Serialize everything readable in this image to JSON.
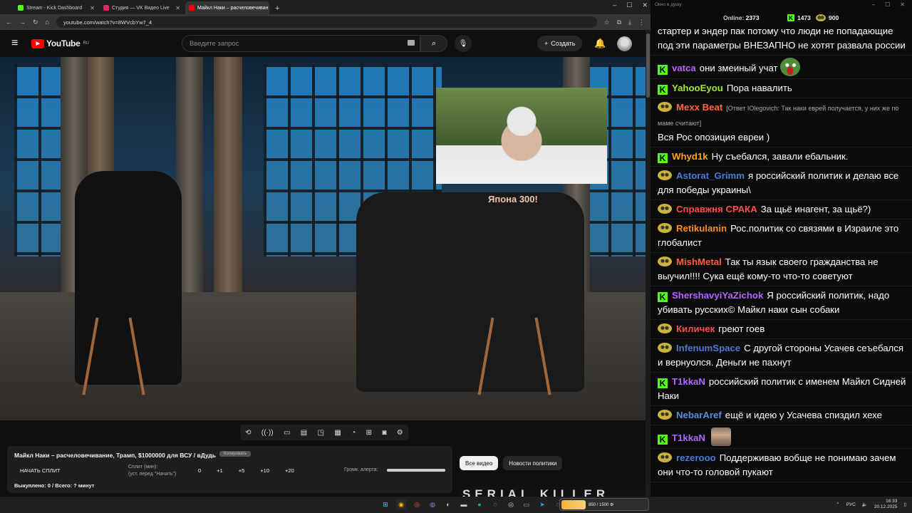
{
  "browser": {
    "tabs": [
      {
        "label": "Stream - Kick Dashboard",
        "color": "#53fc18",
        "active": false
      },
      {
        "label": "Студия — VK Видео Live",
        "color": "#e0245e",
        "active": false
      },
      {
        "label": "Майкл Наки – расчеловечиван",
        "color": "#ff0000",
        "active": true
      }
    ],
    "url": "youtube.com/watch?v=8WVcbYw7_4",
    "new_tab": "+",
    "win_min": "–",
    "win_max": "☐",
    "win_close": "✕"
  },
  "youtube": {
    "logo_text": "YouTube",
    "region": "RU",
    "search_placeholder": "Введите запрос",
    "create_label": "Создать",
    "video_caption": "Япона  300!"
  },
  "controls_panel": {
    "title": "Майкл Наки – расчеловечивание, Трамп, $1000000 для ВСУ / вДудь",
    "copy_label": "Копировать",
    "split_button": "НАЧАТЬ СПЛИТ",
    "split_label": "Сплит (мин):",
    "split_hint": "(уст. перед \"Начать\")",
    "split_values": [
      "0",
      "+1",
      "+5",
      "+10",
      "+20"
    ],
    "alert_volume_label": "Громк. алерта:",
    "sold_label": "Выкуплено: 0 / Всего: ? минут"
  },
  "chips": [
    "Все видео",
    "Новости политики"
  ],
  "thumbnail_text": "SERIAL KILLER",
  "chat": {
    "window_title": "Окно в душу",
    "online_label": "Online:",
    "online_count": "2373",
    "kick_count": "1473",
    "other_count": "900",
    "messages": [
      {
        "badge": "none",
        "user": "",
        "color": "#ffffff",
        "reply": "",
        "text": "стартер и эндер пак потому что люди не попадающие под эти параметры ВНЕЗАПНО не хотят развала россии",
        "emote": ""
      },
      {
        "badge": "kick",
        "user": "vatca",
        "color": "#b266ff",
        "reply": "",
        "text": "они змеиный учат",
        "emote": "pepe"
      },
      {
        "badge": "kick",
        "user": "YahooEyou",
        "color": "#a3e635",
        "reply": "",
        "text": "Пора навалить",
        "emote": ""
      },
      {
        "badge": "pep",
        "user": "Mexx Beat",
        "color": "#ff6a3d",
        "reply": "[Ответ IOlegovich: Так наки еврей получается, у них же по маме считают]",
        "text": "Вся Рос опозиция евреи )",
        "emote": ""
      },
      {
        "badge": "kick",
        "user": "Whyd1k",
        "color": "#ffa31a",
        "reply": "",
        "text": "Ну съебался, завали ебальник.",
        "emote": ""
      },
      {
        "badge": "pep",
        "user": "Astorat_Grimm",
        "color": "#4b7bd4",
        "reply": "",
        "text": "я российский политик и делаю все для победы украины\\",
        "emote": ""
      },
      {
        "badge": "pep",
        "user": "Справжня СРАКА",
        "color": "#ff4d4d",
        "reply": "",
        "text": "За щьё инагент, за щьё?)",
        "emote": ""
      },
      {
        "badge": "pep",
        "user": "Retikulanin",
        "color": "#ff8c1a",
        "reply": "",
        "text": "Рос.политик со связями в Израиле это глобалист",
        "emote": ""
      },
      {
        "badge": "pep",
        "user": "MishMetal",
        "color": "#ff5f3a",
        "reply": "",
        "text": "Так ты язык своего гражданства не выучил!!!! Сука ещё кому-то что-то советуют",
        "emote": ""
      },
      {
        "badge": "kick",
        "user": "ShershavyiYaZichok",
        "color": "#b266ff",
        "reply": "",
        "text": "Я российский политик, надо убивать русских© Майкл наки сын собаки",
        "emote": ""
      },
      {
        "badge": "pep",
        "user": "Киличек",
        "color": "#ff4d4d",
        "reply": "",
        "text": "греют гоев",
        "emote": ""
      },
      {
        "badge": "pep",
        "user": "InfenumSpace",
        "color": "#4b7bd4",
        "reply": "",
        "text": "С другой стороны Усачев сеъебался и вернуолся. Деньги не пахнут",
        "emote": ""
      },
      {
        "badge": "kick",
        "user": "T1kkaN",
        "color": "#b266ff",
        "reply": "",
        "text": "российский политик с именем Майкл Сидней Наки",
        "emote": ""
      },
      {
        "badge": "pep",
        "user": "NebarAref",
        "color": "#5a8fe0",
        "reply": "",
        "text": "ещё и идею у Усачева спиздил хехе",
        "emote": ""
      },
      {
        "badge": "kick",
        "user": "T1kkaN",
        "color": "#b266ff",
        "reply": "",
        "text": "",
        "emote": "face"
      },
      {
        "badge": "pep",
        "user": "rezerooo",
        "color": "#4b7bd4",
        "reply": "",
        "text": "Поддерживаю вобще не понимаю зачем они что-то головой пукают",
        "emote": ""
      }
    ]
  },
  "taskbar": {
    "widget_text": "850 / 1500 ⚙",
    "lang": "РУС",
    "time": "16:33",
    "date": "20.12.2025"
  }
}
